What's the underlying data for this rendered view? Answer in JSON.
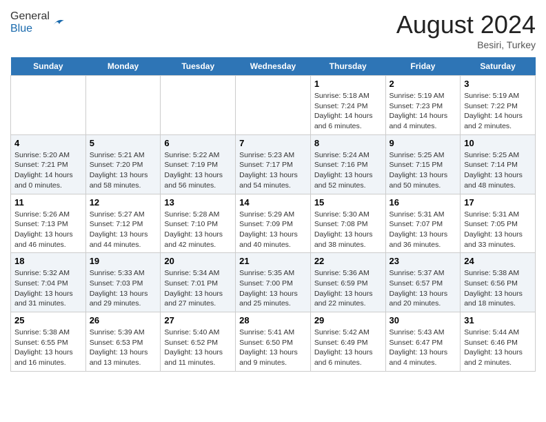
{
  "header": {
    "logo": {
      "general": "General",
      "blue": "Blue"
    },
    "title": "August 2024",
    "location": "Besiri, Turkey"
  },
  "days_of_week": [
    "Sunday",
    "Monday",
    "Tuesday",
    "Wednesday",
    "Thursday",
    "Friday",
    "Saturday"
  ],
  "weeks": [
    [
      {
        "day": "",
        "info": ""
      },
      {
        "day": "",
        "info": ""
      },
      {
        "day": "",
        "info": ""
      },
      {
        "day": "",
        "info": ""
      },
      {
        "day": "1",
        "info": "Sunrise: 5:18 AM\nSunset: 7:24 PM\nDaylight: 14 hours\nand 6 minutes."
      },
      {
        "day": "2",
        "info": "Sunrise: 5:19 AM\nSunset: 7:23 PM\nDaylight: 14 hours\nand 4 minutes."
      },
      {
        "day": "3",
        "info": "Sunrise: 5:19 AM\nSunset: 7:22 PM\nDaylight: 14 hours\nand 2 minutes."
      }
    ],
    [
      {
        "day": "4",
        "info": "Sunrise: 5:20 AM\nSunset: 7:21 PM\nDaylight: 14 hours\nand 0 minutes."
      },
      {
        "day": "5",
        "info": "Sunrise: 5:21 AM\nSunset: 7:20 PM\nDaylight: 13 hours\nand 58 minutes."
      },
      {
        "day": "6",
        "info": "Sunrise: 5:22 AM\nSunset: 7:19 PM\nDaylight: 13 hours\nand 56 minutes."
      },
      {
        "day": "7",
        "info": "Sunrise: 5:23 AM\nSunset: 7:17 PM\nDaylight: 13 hours\nand 54 minutes."
      },
      {
        "day": "8",
        "info": "Sunrise: 5:24 AM\nSunset: 7:16 PM\nDaylight: 13 hours\nand 52 minutes."
      },
      {
        "day": "9",
        "info": "Sunrise: 5:25 AM\nSunset: 7:15 PM\nDaylight: 13 hours\nand 50 minutes."
      },
      {
        "day": "10",
        "info": "Sunrise: 5:25 AM\nSunset: 7:14 PM\nDaylight: 13 hours\nand 48 minutes."
      }
    ],
    [
      {
        "day": "11",
        "info": "Sunrise: 5:26 AM\nSunset: 7:13 PM\nDaylight: 13 hours\nand 46 minutes."
      },
      {
        "day": "12",
        "info": "Sunrise: 5:27 AM\nSunset: 7:12 PM\nDaylight: 13 hours\nand 44 minutes."
      },
      {
        "day": "13",
        "info": "Sunrise: 5:28 AM\nSunset: 7:10 PM\nDaylight: 13 hours\nand 42 minutes."
      },
      {
        "day": "14",
        "info": "Sunrise: 5:29 AM\nSunset: 7:09 PM\nDaylight: 13 hours\nand 40 minutes."
      },
      {
        "day": "15",
        "info": "Sunrise: 5:30 AM\nSunset: 7:08 PM\nDaylight: 13 hours\nand 38 minutes."
      },
      {
        "day": "16",
        "info": "Sunrise: 5:31 AM\nSunset: 7:07 PM\nDaylight: 13 hours\nand 36 minutes."
      },
      {
        "day": "17",
        "info": "Sunrise: 5:31 AM\nSunset: 7:05 PM\nDaylight: 13 hours\nand 33 minutes."
      }
    ],
    [
      {
        "day": "18",
        "info": "Sunrise: 5:32 AM\nSunset: 7:04 PM\nDaylight: 13 hours\nand 31 minutes."
      },
      {
        "day": "19",
        "info": "Sunrise: 5:33 AM\nSunset: 7:03 PM\nDaylight: 13 hours\nand 29 minutes."
      },
      {
        "day": "20",
        "info": "Sunrise: 5:34 AM\nSunset: 7:01 PM\nDaylight: 13 hours\nand 27 minutes."
      },
      {
        "day": "21",
        "info": "Sunrise: 5:35 AM\nSunset: 7:00 PM\nDaylight: 13 hours\nand 25 minutes."
      },
      {
        "day": "22",
        "info": "Sunrise: 5:36 AM\nSunset: 6:59 PM\nDaylight: 13 hours\nand 22 minutes."
      },
      {
        "day": "23",
        "info": "Sunrise: 5:37 AM\nSunset: 6:57 PM\nDaylight: 13 hours\nand 20 minutes."
      },
      {
        "day": "24",
        "info": "Sunrise: 5:38 AM\nSunset: 6:56 PM\nDaylight: 13 hours\nand 18 minutes."
      }
    ],
    [
      {
        "day": "25",
        "info": "Sunrise: 5:38 AM\nSunset: 6:55 PM\nDaylight: 13 hours\nand 16 minutes."
      },
      {
        "day": "26",
        "info": "Sunrise: 5:39 AM\nSunset: 6:53 PM\nDaylight: 13 hours\nand 13 minutes."
      },
      {
        "day": "27",
        "info": "Sunrise: 5:40 AM\nSunset: 6:52 PM\nDaylight: 13 hours\nand 11 minutes."
      },
      {
        "day": "28",
        "info": "Sunrise: 5:41 AM\nSunset: 6:50 PM\nDaylight: 13 hours\nand 9 minutes."
      },
      {
        "day": "29",
        "info": "Sunrise: 5:42 AM\nSunset: 6:49 PM\nDaylight: 13 hours\nand 6 minutes."
      },
      {
        "day": "30",
        "info": "Sunrise: 5:43 AM\nSunset: 6:47 PM\nDaylight: 13 hours\nand 4 minutes."
      },
      {
        "day": "31",
        "info": "Sunrise: 5:44 AM\nSunset: 6:46 PM\nDaylight: 13 hours\nand 2 minutes."
      }
    ]
  ]
}
